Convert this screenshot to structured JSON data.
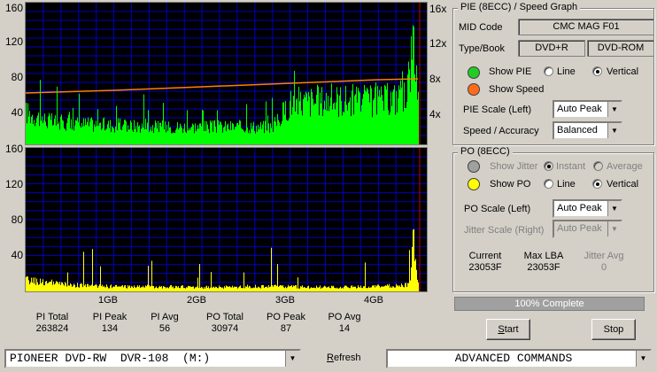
{
  "chart_data": [
    {
      "type": "area",
      "name": "PIE (8ECC)",
      "x_ticks": [
        "1GB",
        "2GB",
        "3GB",
        "4GB"
      ],
      "ylim_left": [
        0,
        160
      ],
      "yticks_left": [
        "160",
        "120",
        "80",
        "40"
      ],
      "yticks_right": [
        "16x",
        "12x",
        "8x",
        "4x"
      ],
      "ylim_right": [
        0,
        16
      ],
      "pie_profile": [
        {
          "x": 0.0,
          "y": 40
        },
        {
          "x": 0.3,
          "y": 28
        },
        {
          "x": 0.6,
          "y": 26
        },
        {
          "x": 1.0,
          "y": 24
        },
        {
          "x": 1.5,
          "y": 22
        },
        {
          "x": 2.0,
          "y": 22
        },
        {
          "x": 2.5,
          "y": 22
        },
        {
          "x": 2.8,
          "y": 22
        },
        {
          "x": 3.0,
          "y": 52
        },
        {
          "x": 3.5,
          "y": 56
        },
        {
          "x": 4.0,
          "y": 54
        },
        {
          "x": 4.3,
          "y": 60
        },
        {
          "x": 4.4,
          "y": 128
        },
        {
          "x": 4.45,
          "y": 60
        }
      ],
      "speed_line": [
        {
          "x": 0.0,
          "y": 5.8
        },
        {
          "x": 1.0,
          "y": 6.1
        },
        {
          "x": 2.0,
          "y": 6.5
        },
        {
          "x": 3.0,
          "y": 6.9
        },
        {
          "x": 4.0,
          "y": 7.3
        },
        {
          "x": 4.45,
          "y": 7.4
        }
      ],
      "colors": {
        "pie": "#00ff00",
        "speed": "#ff8000",
        "grid": "#0000c0"
      }
    },
    {
      "type": "area",
      "name": "PO (8ECC)",
      "x_ticks": [
        "1GB",
        "2GB",
        "3GB",
        "4GB"
      ],
      "ylim": [
        0,
        160
      ],
      "yticks": [
        "160",
        "120",
        "80",
        "40"
      ],
      "po_profile": [
        {
          "x": 0.0,
          "y": 14
        },
        {
          "x": 0.5,
          "y": 8
        },
        {
          "x": 1.0,
          "y": 6
        },
        {
          "x": 1.5,
          "y": 6
        },
        {
          "x": 2.0,
          "y": 5
        },
        {
          "x": 2.5,
          "y": 6
        },
        {
          "x": 3.0,
          "y": 6
        },
        {
          "x": 3.5,
          "y": 5
        },
        {
          "x": 4.0,
          "y": 6
        },
        {
          "x": 4.35,
          "y": 8
        },
        {
          "x": 4.4,
          "y": 70
        },
        {
          "x": 4.45,
          "y": 10
        }
      ],
      "colors": {
        "po": "#ffff00",
        "grid": "#0000c0"
      }
    }
  ],
  "stats": [
    {
      "label": "PI Total",
      "value": "263824"
    },
    {
      "label": "PI Peak",
      "value": "134"
    },
    {
      "label": "PI Avg",
      "value": "56"
    },
    {
      "label": "PO Total",
      "value": "30974"
    },
    {
      "label": "PO Peak",
      "value": "87"
    },
    {
      "label": "PO Avg",
      "value": "14"
    }
  ],
  "pie_group": {
    "title": "PIE (8ECC) / Speed Graph",
    "mid_label": "MID Code",
    "mid_value": "CMC MAG F01",
    "type_label": "Type/Book",
    "type_value": "DVD+R",
    "book_value": "DVD-ROM",
    "show_pie": "Show PIE",
    "show_speed": "Show Speed",
    "line": "Line",
    "vertical": "Vertical",
    "scale_label": "PIE Scale (Left)",
    "scale_value": "Auto Peak",
    "accuracy_label": "Speed / Accuracy",
    "accuracy_value": "Balanced",
    "colors": {
      "pie_dot": "#22cc22",
      "speed_dot": "#ff6a1a"
    }
  },
  "po_group": {
    "title": "PO (8ECC)",
    "show_jitter": "Show Jitter",
    "instant": "Instant",
    "average": "Average",
    "show_po": "Show PO",
    "line": "Line",
    "vertical": "Vertical",
    "scale_label": "PO Scale (Left)",
    "scale_value": "Auto Peak",
    "jitter_scale_label": "Jitter Scale (Right)",
    "jitter_scale_value": "Auto Peak",
    "current_label": "Current",
    "current_value": "23053F",
    "maxlba_label": "Max LBA",
    "maxlba_value": "23053F",
    "jitter_avg_label": "Jitter Avg",
    "jitter_avg_value": "0",
    "colors": {
      "jitter_dot": "#a0a0a0",
      "po_dot": "#ffff00"
    }
  },
  "progress": {
    "text": "100% Complete",
    "percent": 100
  },
  "buttons": {
    "start": "Start",
    "stop": "Stop",
    "refresh": "Refresh"
  },
  "drive": {
    "value": "PIONEER DVD-RW  DVR-108  (M:)"
  },
  "commands": {
    "value": "ADVANCED COMMANDS"
  }
}
